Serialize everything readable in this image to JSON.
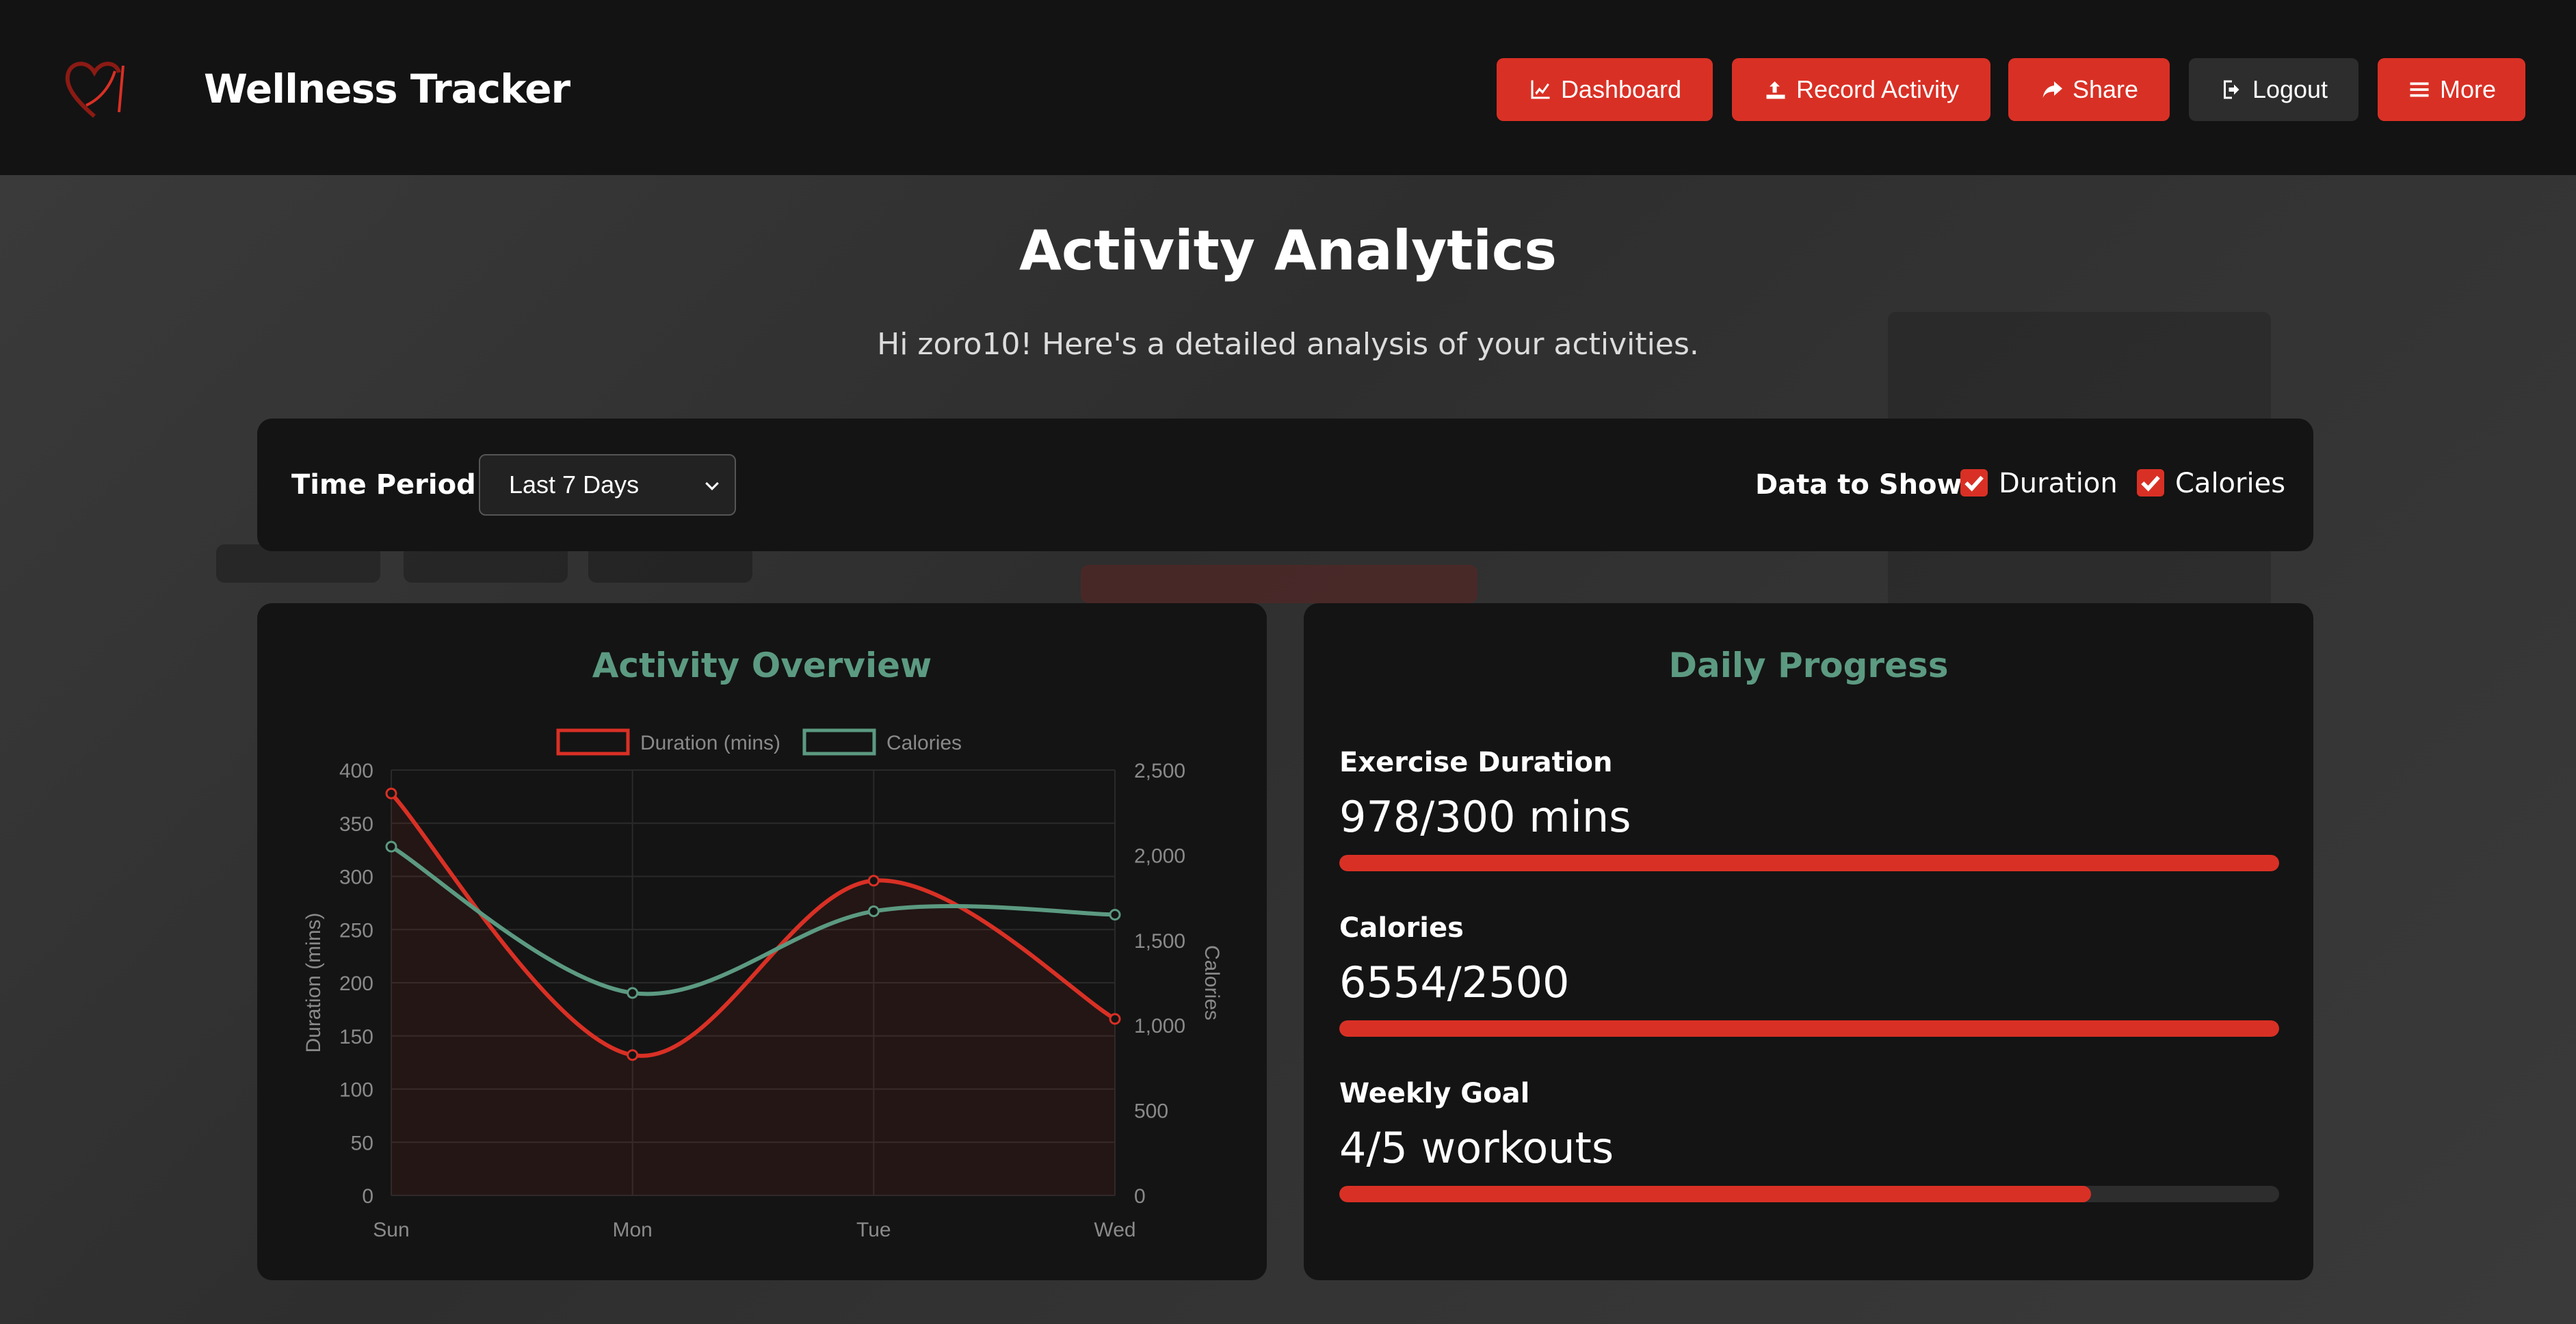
{
  "header": {
    "app_title": "Wellness Tracker",
    "nav": [
      {
        "label": "Dashboard",
        "icon": "chart-line-icon"
      },
      {
        "label": "Record Activity",
        "icon": "upload-icon"
      },
      {
        "label": "Share",
        "icon": "share-icon"
      },
      {
        "label": "Logout",
        "icon": "logout-icon"
      },
      {
        "label": "More",
        "icon": "menu-icon"
      }
    ]
  },
  "main": {
    "title": "Activity Analytics",
    "subtitle": "Hi zoro10! Here's a detailed analysis of your activities."
  },
  "filters": {
    "time_period_label": "Time Period:",
    "time_period_value": "Last 7 Days",
    "data_label": "Data to Show:",
    "duration_label": "Duration",
    "duration_checked": true,
    "calories_label": "Calories",
    "calories_checked": true
  },
  "overview": {
    "title": "Activity Overview"
  },
  "chart_data": {
    "type": "line",
    "categories": [
      "Sun",
      "Mon",
      "Tue",
      "Wed"
    ],
    "series": [
      {
        "name": "Duration (mins)",
        "values": [
          378,
          132,
          296,
          166
        ],
        "axis": "left",
        "color": "#d93025"
      },
      {
        "name": "Calories",
        "values": [
          2050,
          1190,
          1670,
          1650
        ],
        "axis": "right",
        "color": "#5c9a82"
      }
    ],
    "ylabel": "Duration (mins)",
    "ylabel_right": "Calories",
    "ylim": [
      0,
      400
    ],
    "ylim_right": [
      0,
      2500
    ],
    "yticks": [
      "0",
      "50",
      "100",
      "150",
      "200",
      "250",
      "300",
      "350",
      "400"
    ],
    "yticks_right": [
      "0",
      "500",
      "1,000",
      "1,500",
      "2,000",
      "2,500"
    ],
    "legend": "top-center",
    "grid": true
  },
  "progress": {
    "title": "Daily Progress",
    "items": [
      {
        "label": "Exercise Duration",
        "value": "978/300 mins",
        "fraction": 1.0
      },
      {
        "label": "Calories",
        "value": "6554/2500",
        "fraction": 1.0
      },
      {
        "label": "Weekly Goal",
        "value": "4/5 workouts",
        "fraction": 0.8
      }
    ]
  },
  "colors": {
    "accent": "#d93025",
    "teal": "#5c9a82",
    "panel": "#141414"
  }
}
